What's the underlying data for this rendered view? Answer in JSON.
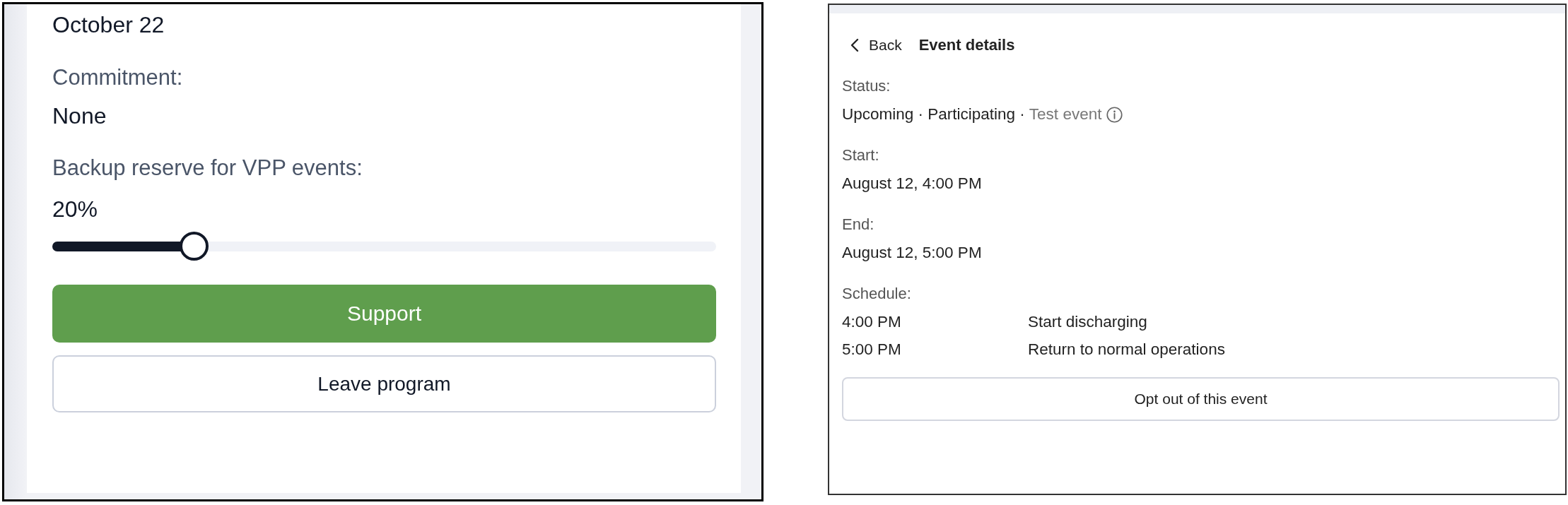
{
  "settings": {
    "date": "October 22",
    "commitment": {
      "label": "Commitment:",
      "value": "None"
    },
    "backup_reserve": {
      "label": "Backup reserve for VPP events:",
      "reading": "20%",
      "level": 0.2
    },
    "buttons": [
      {
        "label": "Support",
        "kind": "primary"
      },
      {
        "label": "Leave program",
        "kind": "secondary"
      }
    ]
  },
  "event_details": {
    "back": "Back",
    "title": "Event details",
    "status": {
      "label": "Status:",
      "value": "Upcoming · Participating ·",
      "note": "Test event"
    },
    "fields": [
      {
        "label": "Start:",
        "value": "August 12, 4:00 PM"
      },
      {
        "label": "End:",
        "value": "August 12, 5:00 PM"
      }
    ],
    "schedule": {
      "label": "Schedule:",
      "rows": [
        {
          "time": "4:00 PM",
          "action": "Start discharging"
        },
        {
          "time": "5:00 PM",
          "action": "Return to normal operations"
        }
      ]
    },
    "button": "Opt out of this event"
  }
}
